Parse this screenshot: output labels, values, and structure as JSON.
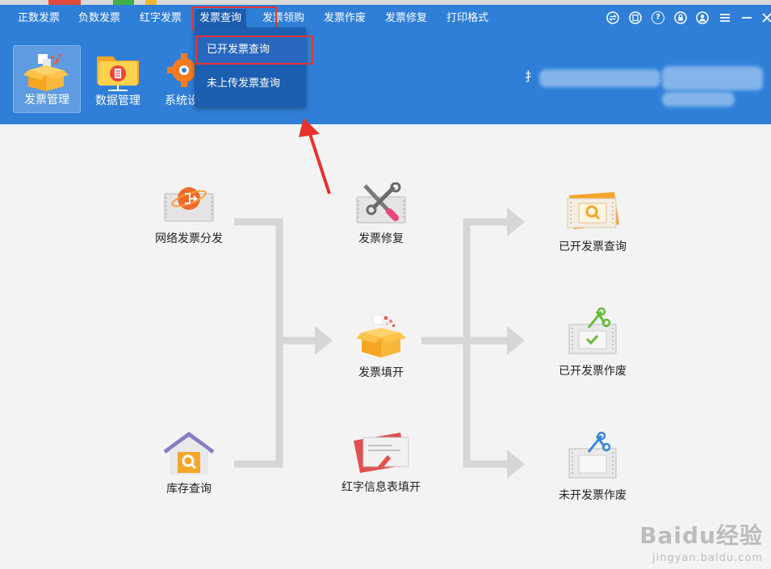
{
  "menu": {
    "items": [
      "正数发票",
      "负数发票",
      "红字发票",
      "发票查询",
      "发票领购",
      "发票作废",
      "发票修复",
      "打印格式"
    ],
    "active_index": 3
  },
  "window_controls": {
    "icons": [
      "swap-icon",
      "note-icon",
      "help-icon",
      "lock-icon",
      "user-icon",
      "menu-icon",
      "minimize-icon",
      "close-icon"
    ],
    "help_glyph": "?"
  },
  "toolbar": {
    "items": [
      {
        "label": "发票管理",
        "icon": "invoice-box-icon",
        "selected": true
      },
      {
        "label": "数据管理",
        "icon": "data-folder-icon",
        "selected": false
      },
      {
        "label": "系统设",
        "icon": "system-gear-icon",
        "selected": false
      }
    ]
  },
  "dropdown": {
    "items": [
      "已开发票查询",
      "未上传发票查询"
    ],
    "highlighted_index": 0
  },
  "header_partial_text": "扌",
  "flow": {
    "left": [
      {
        "label": "网络发票分发",
        "icon": "network-distribute-icon"
      },
      {
        "label": "库存查询",
        "icon": "inventory-house-icon"
      }
    ],
    "center": [
      {
        "label": "发票修复",
        "icon": "repair-tools-icon"
      },
      {
        "label": "发票填开",
        "icon": "invoice-fill-box-icon"
      },
      {
        "label": "红字信息表填开",
        "icon": "red-info-form-icon"
      }
    ],
    "right": [
      {
        "label": "已开发票查询",
        "icon": "issued-invoice-search-icon"
      },
      {
        "label": "已开发票作废",
        "icon": "issued-invoice-void-icon"
      },
      {
        "label": "未开发票作废",
        "icon": "unissued-invoice-void-icon"
      }
    ]
  },
  "watermark": {
    "line1": "Baidu经验",
    "line2": "jingyan.baidu.com"
  },
  "colors": {
    "header": "#2f7fd8",
    "accent_dark": "#1c5eb0",
    "highlight_red": "#e8322e",
    "connector": "#d6d6d6"
  }
}
